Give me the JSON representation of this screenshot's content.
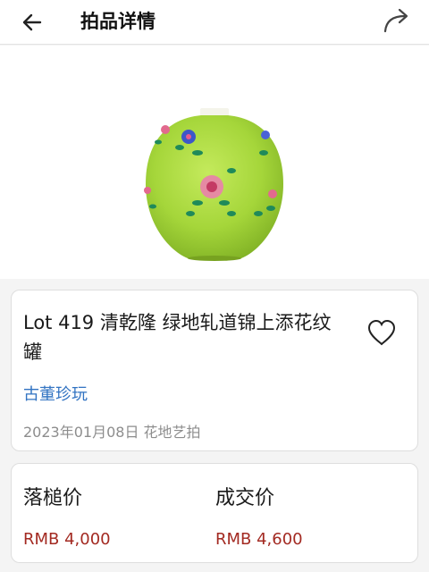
{
  "header": {
    "title": "拍品详情",
    "back_icon": "arrow-left-icon",
    "share_icon": "share-forward-icon"
  },
  "hero": {
    "image": "celadon-green famille-rose jar with floral design"
  },
  "lot": {
    "title": "Lot 419  清乾隆   绿地轧道锦上添花纹罐",
    "category": "古董珍玩",
    "meta": "2023年01月08日 花地艺拍",
    "favorite_icon": "heart-outline-icon"
  },
  "prices": {
    "hammer_label": "落槌价",
    "hammer_value": "RMB 4,000",
    "deal_label": "成交价",
    "deal_value": "RMB 4,600"
  },
  "colors": {
    "link": "#3173c2",
    "price": "#a32a22",
    "vase_body": "#a5d63a"
  }
}
